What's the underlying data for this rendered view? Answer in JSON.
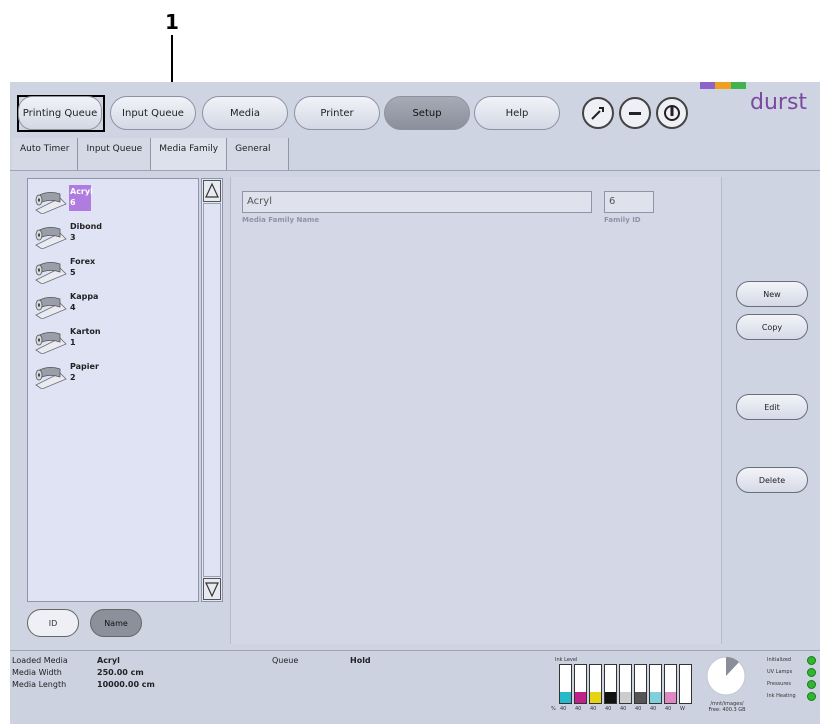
{
  "callout": {
    "number": "1"
  },
  "toolbar": {
    "printing_queue": "Printing Queue",
    "input_queue": "Input Queue",
    "media": "Media",
    "printer": "Printer",
    "setup": "Setup",
    "help": "Help"
  },
  "logo": {
    "text": "durst",
    "colors": [
      "#8e63c9",
      "#f0a020",
      "#3fb34f"
    ]
  },
  "tabs": [
    "Auto Timer",
    "Input Queue",
    "Media Family",
    "General"
  ],
  "media_list": [
    {
      "name": "Acryl",
      "id": "6",
      "selected": true
    },
    {
      "name": "Dibond",
      "id": "3",
      "selected": false
    },
    {
      "name": "Forex",
      "id": "5",
      "selected": false
    },
    {
      "name": "Kappa",
      "id": "4",
      "selected": false
    },
    {
      "name": "Karton",
      "id": "1",
      "selected": false
    },
    {
      "name": "Papier",
      "id": "2",
      "selected": false
    }
  ],
  "sort": {
    "id_label": "ID",
    "name_label": "Name"
  },
  "detail": {
    "name_value": "Acryl",
    "name_label": "Media Family Name",
    "id_value": "6",
    "id_label": "Family ID"
  },
  "actions": {
    "new": "New",
    "copy": "Copy",
    "edit": "Edit",
    "delete": "Delete"
  },
  "status": {
    "loaded_media_label": "Loaded Media",
    "loaded_media_value": "Acryl",
    "media_width_label": "Media Width",
    "media_width_value": "250.00 cm",
    "media_length_label": "Media Length",
    "media_length_value": "10000.00 cm",
    "queue_label": "Queue",
    "queue_value": "Hold",
    "ink_level_label": "Ink Level",
    "ink_pct_prefix": "%",
    "ink_bars": [
      {
        "color": "#27b9c9",
        "level": 0.3,
        "pct": "40"
      },
      {
        "color": "#c0208a",
        "level": 0.3,
        "pct": "40"
      },
      {
        "color": "#e6d414",
        "level": 0.3,
        "pct": "40"
      },
      {
        "color": "#111111",
        "level": 0.3,
        "pct": "40"
      },
      {
        "color": "#cccccc",
        "level": 0.3,
        "pct": "40"
      },
      {
        "color": "#555555",
        "level": 0.3,
        "pct": "40"
      },
      {
        "color": "#7fd0db",
        "level": 0.3,
        "pct": "40"
      },
      {
        "color": "#e088c4",
        "level": 0.3,
        "pct": "40"
      },
      {
        "color": "#ffffff",
        "level": 0.0,
        "pct": "W"
      }
    ],
    "disk_used_fraction": 0.12,
    "disk_label": "/mnt/images/",
    "disk_free": "Free: 400.3 GB",
    "indicators": [
      "Initialized",
      "UV Lamps",
      "Pressures",
      "Ink Heating"
    ]
  }
}
